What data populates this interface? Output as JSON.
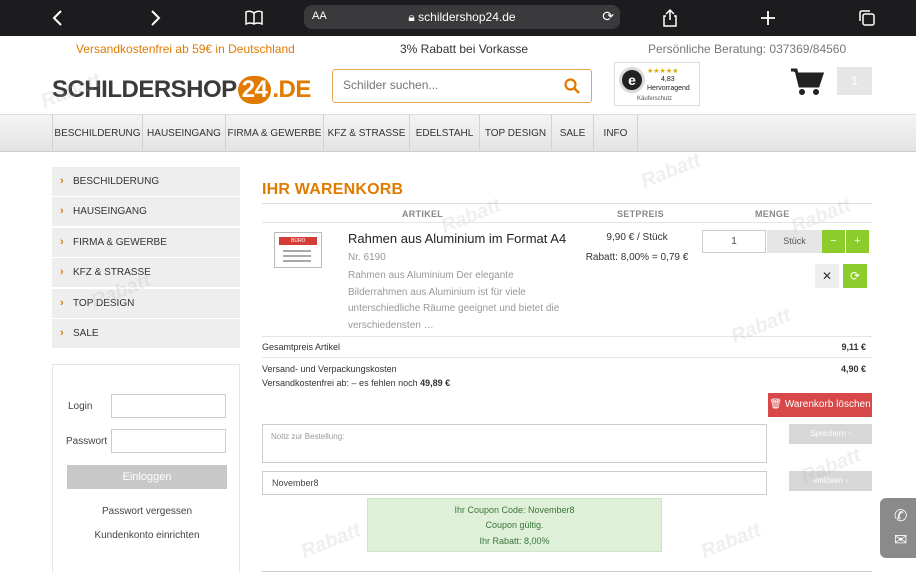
{
  "browser": {
    "aa_label": "AA",
    "url": "schildershop24.de",
    "icons": [
      "back-icon",
      "forward-icon",
      "bookmarks-icon",
      "share-icon",
      "plus-icon",
      "tabs-icon"
    ]
  },
  "info_strip": {
    "free_shipping": "Versandkostenfrei ab 59€ in Deutschland",
    "discount": "3% Rabatt bei Vorkasse",
    "phone": "Persönliche Beratung: 037369/84560"
  },
  "header": {
    "logo_left": "SCHILDERSHOP",
    "logo_num": "24",
    "logo_right": ".DE",
    "search_placeholder": "Schilder suchen...",
    "trust_letter": "e",
    "trust_stars": "★★★★★",
    "trust_score": "4,83",
    "trust_word": "Hervorragend",
    "trust_sub": "Käuferschutz",
    "cart_count": "1"
  },
  "nav": [
    "BESCHILDERUNG",
    "HAUSEINGANG",
    "FIRMA & GEWERBE",
    "KFZ & STRASSE",
    "EDELSTAHL",
    "TOP DESIGN",
    "SALE",
    "INFO"
  ],
  "sidebar": {
    "categories": [
      "BESCHILDERUNG",
      "HAUSEINGANG",
      "FIRMA & GEWERBE",
      "KFZ & STRASSE",
      "TOP DESIGN",
      "SALE"
    ],
    "login_label": "Login",
    "password_label": "Passwort",
    "login_button": "Einloggen",
    "forgot_password": "Passwort vergessen",
    "create_account": "Kundenkonto einrichten"
  },
  "cart": {
    "title": "IHR WARENKORB",
    "col_article": "ARTIKEL",
    "col_price": "SETPREIS",
    "col_qty": "MENGE",
    "item": {
      "name": "Rahmen aus Aluminium im Format A4",
      "number": "Nr. 6190",
      "description": "Rahmen aus Aluminium Der elegante Bilderrahmen aus Aluminium ist für viele unterschiedliche Räume geeignet und bietet die verschiedensten …",
      "unit_price": "9,90 € / Stück",
      "discount": "Rabatt: 8,00% = 0,79 €",
      "quantity": "1",
      "unit": "Stück",
      "minus": "−",
      "plus": "+",
      "remove_symbol": "✕",
      "refresh_symbol": "⟳",
      "thumb_text": "BÜRO"
    },
    "total_label": "Gesamtpreis Artikel",
    "total_value": "9,11 €",
    "shipping_label": "Versand- und Verpackungskosten",
    "shipping_value": "4,90 €",
    "free_shipping_note": "Versandkostenfrei ab: – es fehlen noch",
    "free_shipping_amount": "49,89 €",
    "clear_button": "Warenkorb löschen",
    "note_placeholder": "Notiz zur Bestellung:",
    "save_button": "Speichern",
    "coupon_value": "November8",
    "redeem_button": "einlösen",
    "coupon_code_line": "Ihr Coupon Code: November8",
    "coupon_valid_line": "Coupon gültig.",
    "coupon_discount_line": "Ihr Rabatt: 8,00%"
  },
  "colors": {
    "accent_orange": "#e07b00",
    "green": "#8ccc2b",
    "red": "#d94848",
    "success_bg": "#dff0d8"
  }
}
